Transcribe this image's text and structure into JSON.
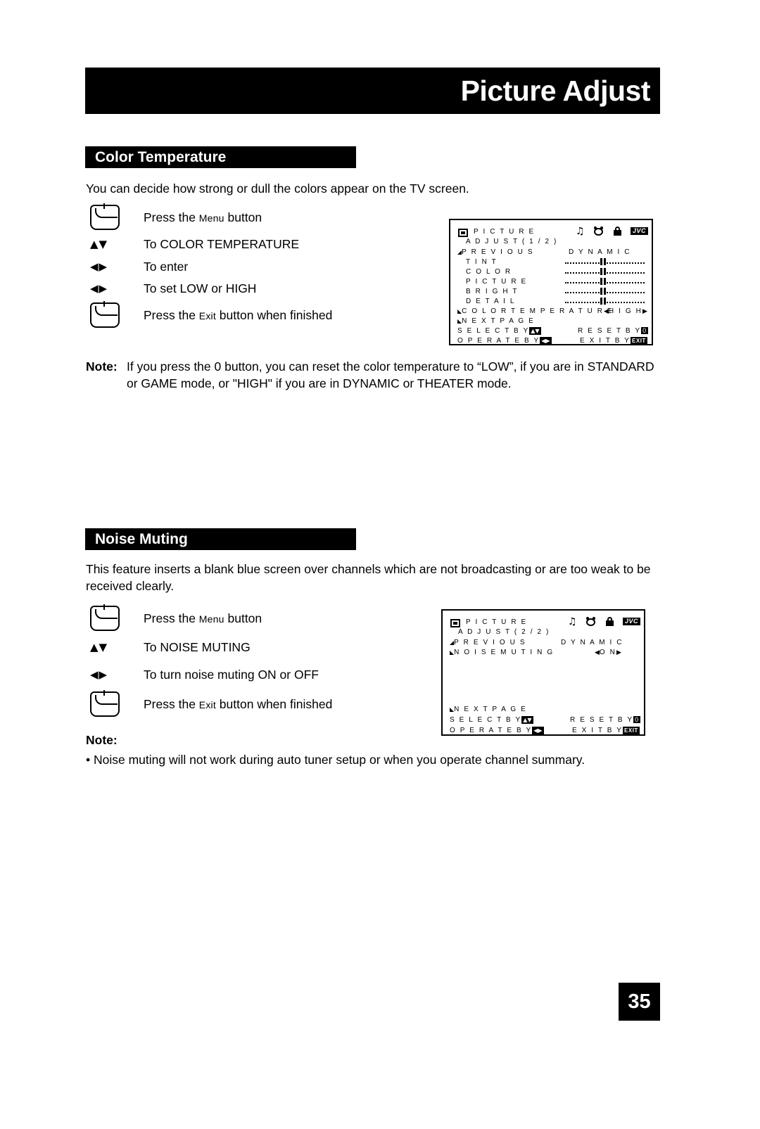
{
  "header": {
    "title": "Picture Adjust"
  },
  "page_number": "35",
  "sections": [
    {
      "heading": "Color Temperature",
      "intro": "You can decide how strong or dull the colors appear on the TV screen.",
      "steps": [
        {
          "icon": "remote-button-key",
          "text_pre": "Press the ",
          "text_sc": "Menu",
          "text_post": " button"
        },
        {
          "icon": "up-down-arrows",
          "text": "To COLOR TEMPERATURE"
        },
        {
          "icon": "left-right-arrows",
          "text": "To enter"
        },
        {
          "icon": "left-right-arrows",
          "text": "To set LOW or HIGH"
        },
        {
          "icon": "remote-button-key",
          "text_pre": "Press the ",
          "text_sc": "Exit",
          "text_post": " button when finished"
        }
      ],
      "note_label": "Note:",
      "note_body": "If you press the 0 button, you can reset the color temperature to “LOW”, if you are in STANDARD or GAME mode, or \"HIGH\" if you are in DYNAMIC or THEATER mode."
    },
    {
      "heading": "Noise Muting",
      "intro": "This feature inserts a blank blue screen over channels which are not broadcasting or are too weak to be received clearly.",
      "steps": [
        {
          "icon": "remote-button-key",
          "text_pre": "Press the ",
          "text_sc": "Menu",
          "text_post": " button"
        },
        {
          "icon": "up-down-arrows",
          "text": "To NOISE MUTING"
        },
        {
          "icon": "left-right-arrows",
          "text": "To turn noise muting ON or OFF"
        },
        {
          "icon": "remote-button-key",
          "text_pre": "Press the ",
          "text_sc": "Exit",
          "text_post": " button when finished"
        }
      ],
      "note_label": "Note:",
      "note_bullet": "• Noise muting will not work during auto tuner setup or when you operate channel summary."
    }
  ],
  "osd1": {
    "title_line1": "P I C T U R E",
    "title_line2": "A D J U S T  ( 1 / 2 )",
    "previous": "P R E V I O U S",
    "mode": "D Y N A M I C",
    "items": [
      "T I N T",
      "C O L O R",
      "P I C T U R E",
      "B R I G H T",
      "D E T A I L"
    ],
    "color_temp_label": "C O L O R  T E M P E R A T U R E",
    "color_temp_value": "H I G H",
    "next_page": "N E X T  P A G E",
    "select_label": "S E L E C T    B Y",
    "reset_label": "R E S E T  B Y",
    "reset_value": "0",
    "operate_label": "O P E R A T E  B Y",
    "exit_label": "E X I T  B Y",
    "exit_value": "EXIT",
    "brand": "JVC"
  },
  "osd2": {
    "title_line1": "P I C T U R E",
    "title_line2": "A D J U S T  ( 2 / 2 )",
    "previous": "P R E V I O U S",
    "mode": "D Y N A M I C",
    "noise_muting_label": "N O I S E   M U T I N G",
    "noise_muting_value": "O N",
    "next_page": "N E X T  P A G E",
    "select_label": "S E L E C T    B Y",
    "reset_label": "R E S E T  B Y",
    "reset_value": "0",
    "operate_label": "O P E R A T E  B Y",
    "exit_label": "E X I T  B Y",
    "exit_value": "EXIT",
    "brand": "JVC"
  },
  "glyphs": {
    "up_down": "▲▼",
    "left_right": "◀▶",
    "left": "◀",
    "right": "▶",
    "up_small": "▲",
    "down_small": "▼",
    "music_note": "♫",
    "marker_right": "◢",
    "marker_down": "◣"
  }
}
